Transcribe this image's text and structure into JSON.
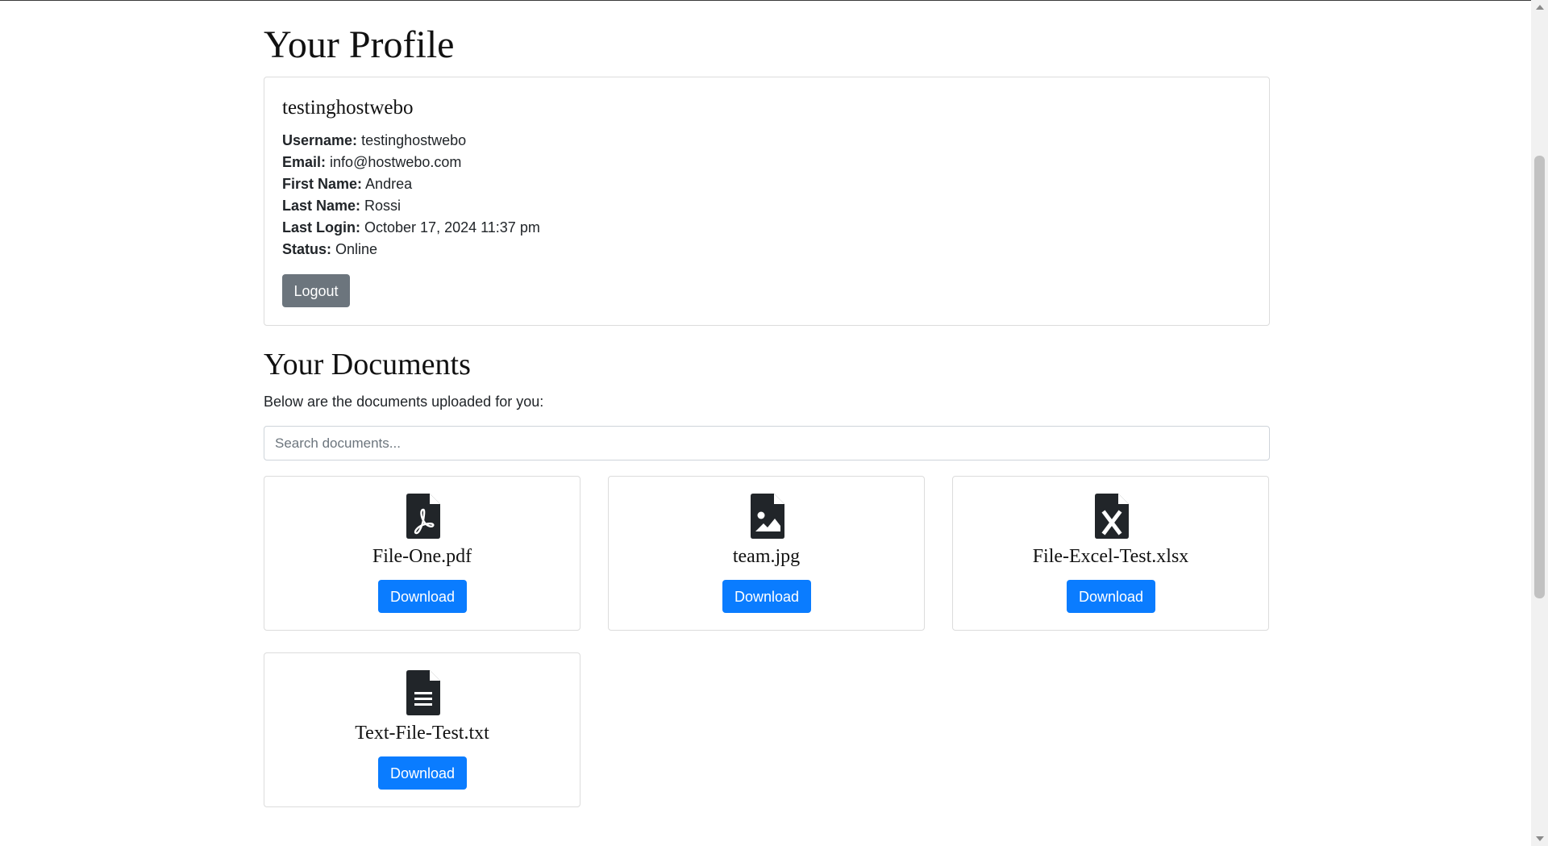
{
  "profile": {
    "page_title": "Your Profile",
    "display_name": "testinghostwebo",
    "fields": [
      {
        "label": "Username:",
        "value": "testinghostwebo"
      },
      {
        "label": "Email:",
        "value": "info@hostwebo.com"
      },
      {
        "label": "First Name:",
        "value": "Andrea"
      },
      {
        "label": "Last Name:",
        "value": "Rossi"
      },
      {
        "label": "Last Login:",
        "value": "October 17, 2024 11:37 pm"
      },
      {
        "label": "Status:",
        "value": "Online"
      }
    ],
    "logout_label": "Logout"
  },
  "documents": {
    "title": "Your Documents",
    "intro": "Below are the documents uploaded for you:",
    "search_placeholder": "Search documents...",
    "items": [
      {
        "name": "File-One.pdf",
        "icon": "pdf-file-icon",
        "button": "Download"
      },
      {
        "name": "team.jpg",
        "icon": "image-file-icon",
        "button": "Download"
      },
      {
        "name": "File-Excel-Test.xlsx",
        "icon": "excel-file-icon",
        "button": "Download"
      },
      {
        "name": "Text-File-Test.txt",
        "icon": "text-file-icon",
        "button": "Download"
      }
    ]
  },
  "colors": {
    "primary": "#0a7cff",
    "secondary": "#6c757d",
    "text": "#212529",
    "border": "#dcdcdc"
  }
}
